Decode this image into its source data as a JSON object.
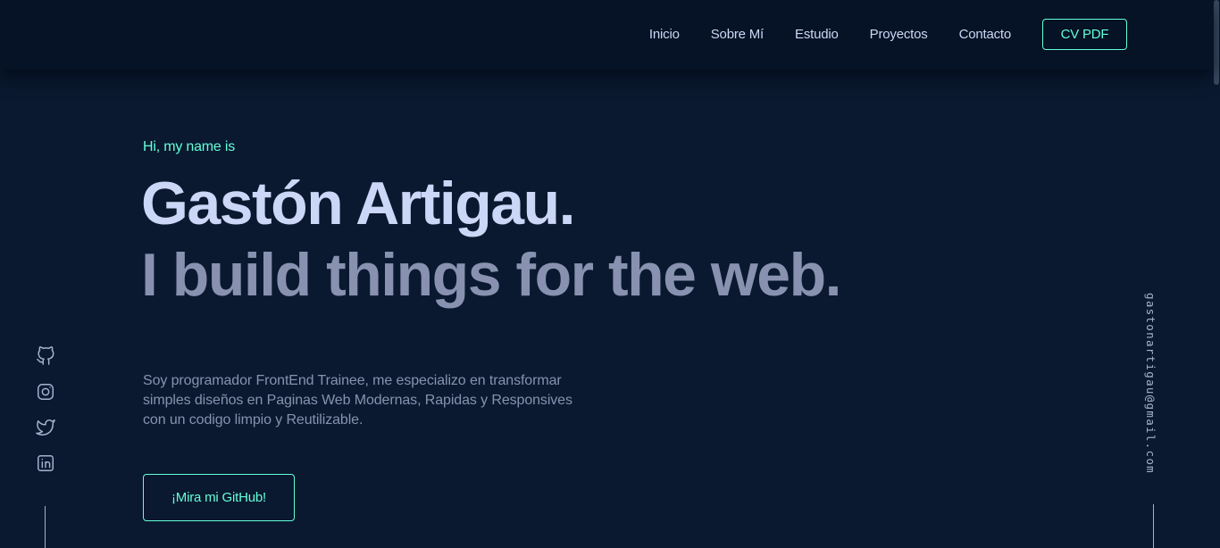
{
  "nav": {
    "items": [
      {
        "label": "Inicio"
      },
      {
        "label": "Sobre Mí"
      },
      {
        "label": "Estudio"
      },
      {
        "label": "Proyectos"
      },
      {
        "label": "Contacto"
      }
    ],
    "cv_label": "CV PDF"
  },
  "hero": {
    "intro": "Hi, my name is",
    "name": "Gastón Artigau.",
    "tagline": "I build things for the web.",
    "description": "Soy programador FrontEnd Trainee, me especializo en transformar simples diseños en Paginas Web Modernas, Rapidas y Responsives con un codigo limpio y Reutilizable.",
    "github_button": "¡Mira mi GitHub!"
  },
  "social": {
    "icons": [
      "github-icon",
      "instagram-icon",
      "twitter-icon",
      "linkedin-icon"
    ]
  },
  "email": "gastonartigau@gmail.com",
  "colors": {
    "background": "#0a192f",
    "header_background": "#061225",
    "accent": "#64ffda",
    "heading": "#ccd6f6",
    "text": "#8892b0",
    "icon": "#a8b2d1"
  }
}
